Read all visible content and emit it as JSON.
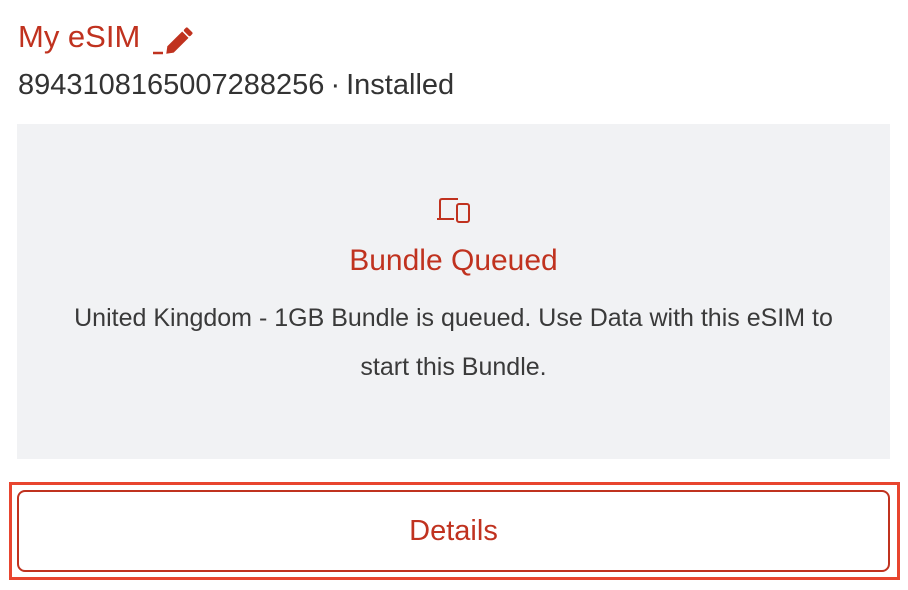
{
  "esim": {
    "name": "My eSIM",
    "iccid": "8943108165007288256",
    "separator": "·",
    "state": "Installed"
  },
  "status": {
    "icon": "devices-icon",
    "title": "Bundle Queued",
    "description": "United Kingdom - 1GB Bundle is queued. Use Data with this eSIM to start this Bundle."
  },
  "actions": {
    "details_label": "Details"
  },
  "colors": {
    "accent": "#c0321f",
    "highlight": "#e8452f",
    "card_bg": "#f1f2f4",
    "text": "#333333"
  }
}
